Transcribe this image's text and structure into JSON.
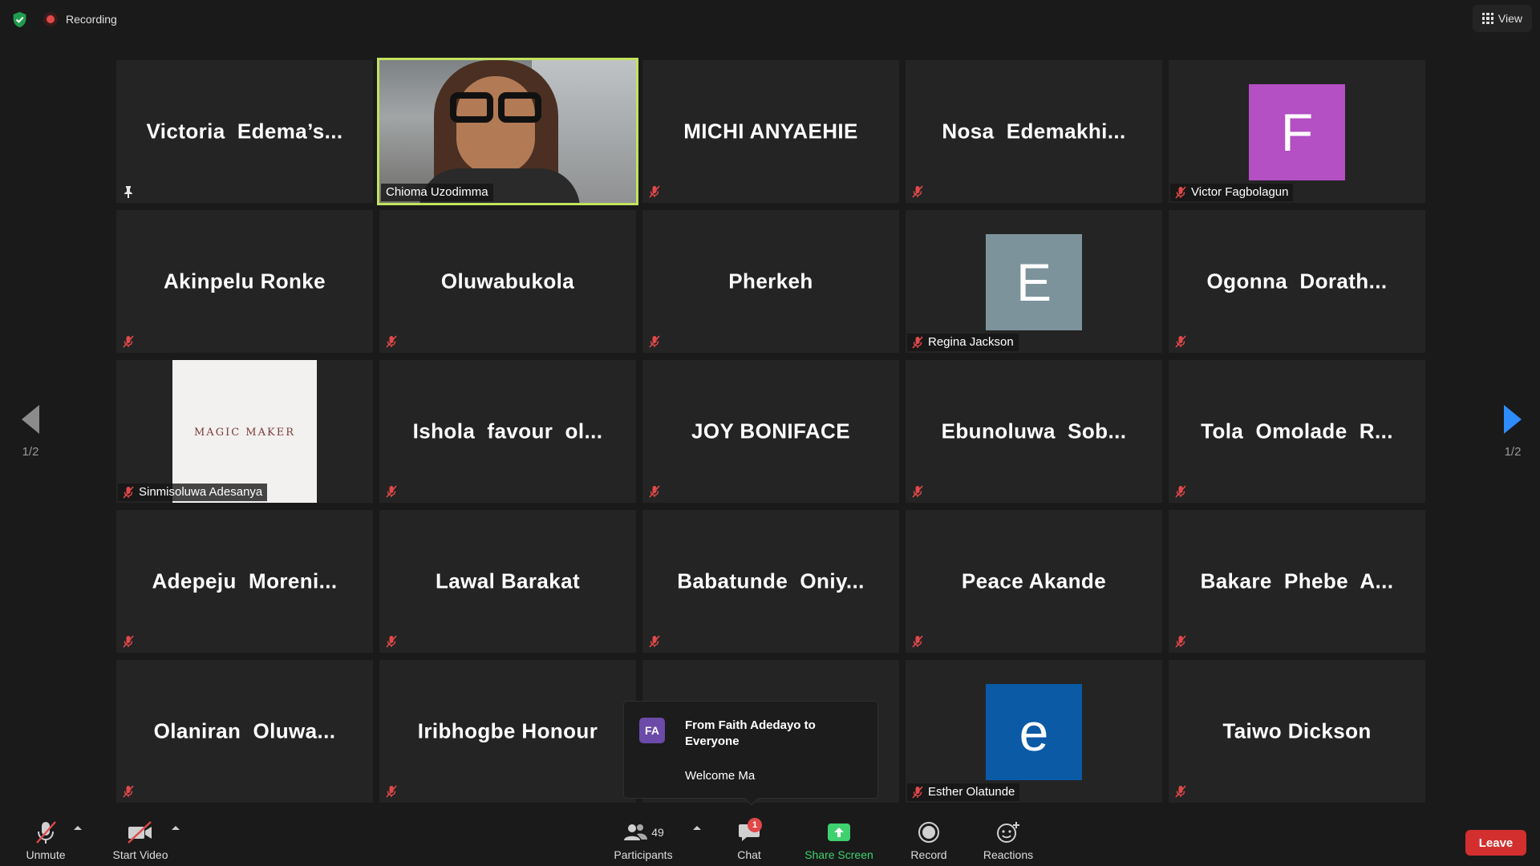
{
  "topbar": {
    "recording_label": "Recording",
    "view_label": "View"
  },
  "pager": {
    "left_text": "1/2",
    "right_text": "1/2"
  },
  "tiles": [
    {
      "name": "Victoria  Edema’s...",
      "type": "name",
      "icon": "pin-icon"
    },
    {
      "name": "Chioma Uzodimma",
      "type": "video",
      "active": true
    },
    {
      "name": "MICHI ANYAEHIE",
      "type": "name",
      "icon": "mic-muted-icon"
    },
    {
      "name": "Nosa  Edemakhi...",
      "type": "name",
      "icon": "mic-muted-icon"
    },
    {
      "name": "Victor Fagbolagun",
      "type": "avatar",
      "avatar_letter": "F",
      "avatar_color": "#b44fc4"
    },
    {
      "name": "Akinpelu Ronke",
      "type": "name",
      "icon": "mic-muted-icon"
    },
    {
      "name": "Oluwabukola",
      "type": "name",
      "icon": "mic-muted-icon"
    },
    {
      "name": "Pherkeh",
      "type": "name",
      "icon": "mic-muted-icon"
    },
    {
      "name": "Regina Jackson",
      "type": "avatar",
      "avatar_letter": "E",
      "avatar_color": "#7d939c"
    },
    {
      "name": "Ogonna  Dorath...",
      "type": "name",
      "icon": "mic-muted-icon"
    },
    {
      "name": "Sinmisoluwa Adesanya",
      "type": "image",
      "image_text": "MAGIC MAKER"
    },
    {
      "name": "Ishola  favour  ol...",
      "type": "name",
      "icon": "mic-muted-icon"
    },
    {
      "name": "JOY BONIFACE",
      "type": "name",
      "icon": "mic-muted-icon"
    },
    {
      "name": "Ebunoluwa  Sob...",
      "type": "name",
      "icon": "mic-muted-icon"
    },
    {
      "name": "Tola  Omolade  R...",
      "type": "name",
      "icon": "mic-muted-icon"
    },
    {
      "name": "Adepeju  Moreni...",
      "type": "name",
      "icon": "mic-muted-icon"
    },
    {
      "name": "Lawal Barakat",
      "type": "name",
      "icon": "mic-muted-icon"
    },
    {
      "name": "Babatunde  Oniy...",
      "type": "name",
      "icon": "mic-muted-icon"
    },
    {
      "name": "Peace Akande",
      "type": "name",
      "icon": "mic-muted-icon"
    },
    {
      "name": "Bakare  Phebe  A...",
      "type": "name",
      "icon": "mic-muted-icon"
    },
    {
      "name": "Olaniran  Oluwa...",
      "type": "name",
      "icon": "mic-muted-icon"
    },
    {
      "name": "Iribhogbe Honour",
      "type": "name",
      "icon": "mic-muted-icon"
    },
    {
      "name": "",
      "type": "empty",
      "icon": "mic-muted-icon"
    },
    {
      "name": "Esther Olatunde",
      "type": "avatar",
      "avatar_letter": "e",
      "avatar_color": "#0b5aa6"
    },
    {
      "name": "Taiwo Dickson",
      "type": "name",
      "icon": "mic-muted-icon"
    }
  ],
  "chat_toast": {
    "initials": "FA",
    "from": "From Faith Adedayo to Everyone",
    "message": "Welcome Ma"
  },
  "toolbar": {
    "unmute_label": "Unmute",
    "start_video_label": "Start Video",
    "participants_label": "Participants",
    "participants_count": "49",
    "chat_label": "Chat",
    "chat_badge": "1",
    "share_screen_label": "Share Screen",
    "record_label": "Record",
    "reactions_label": "Reactions",
    "leave_label": "Leave"
  },
  "colors": {
    "active_speaker_border": "#c2e35e",
    "share_screen_green": "#3fd06f",
    "leave_red": "#d32f2f",
    "accent_blue": "#2d8cff"
  }
}
